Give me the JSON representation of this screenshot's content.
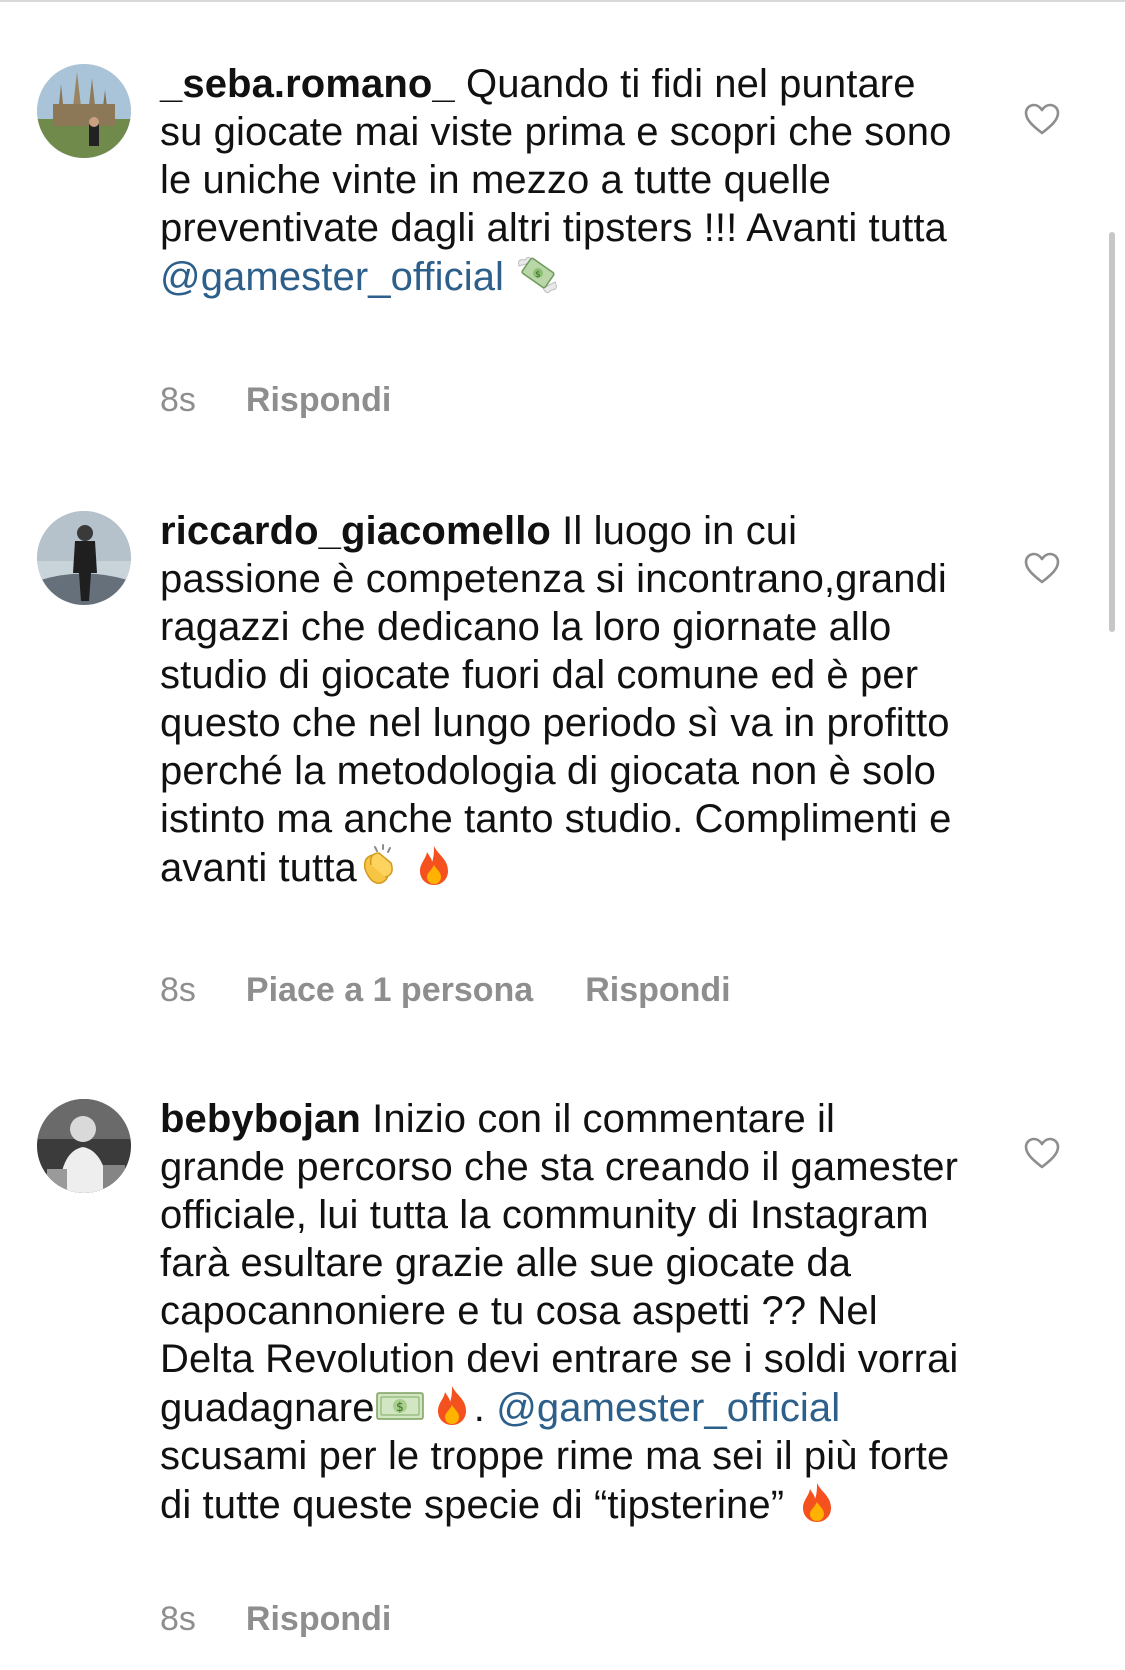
{
  "comments": [
    {
      "username": "_seba.romano_",
      "text": " Quando ti fidi nel puntare su giocate mai viste prima e scopri che sono le uniche vinte in mezzo a tutte quelle preventivate dagli altri tipsters !!! Avanti tutta ",
      "mention": "@gamester_official",
      "emoji_after_mention": "money-with-wings-icon",
      "time": "8s",
      "reply_label": "Rispondi"
    },
    {
      "username": "riccardo_giacomello",
      "text": " Il luogo in cui passione è competenza si incontrano,grandi ragazzi che dedicano la loro giornate allo studio di giocate fuori dal comune ed è per questo che nel lungo periodo sì va in profitto perché la metodologia di giocata non è solo istinto ma anche tanto studio. Complimenti e avanti tutta",
      "emojis": [
        "clapping-hands-icon",
        "fire-icon"
      ],
      "time": "8s",
      "likes_label": "Piace a 1 persona",
      "reply_label": "Rispondi"
    },
    {
      "username": "bebybojan",
      "text_part1": " Inizio con il commentare il grande percorso che sta creando il gamester officiale, lui tutta la community di Instagram farà esultare grazie alle sue giocate da capocannoniere e tu cosa aspetti ?? Nel Delta Revolution devi entrare se i soldi vorrai guadagnare",
      "text_part2": ". ",
      "mention": "@gamester_official",
      "text_part3": " scusami per le troppe rime ma sei il più forte di tutte queste specie di “tipsterine” ",
      "emojis": [
        "dollar-banknote-icon",
        "fire-icon",
        "fire-icon"
      ],
      "time": "8s",
      "reply_label": "Rispondi"
    }
  ],
  "colors": {
    "mention": "#2c5f8a",
    "meta_gray": "#8e8e8e",
    "text": "#111111"
  }
}
